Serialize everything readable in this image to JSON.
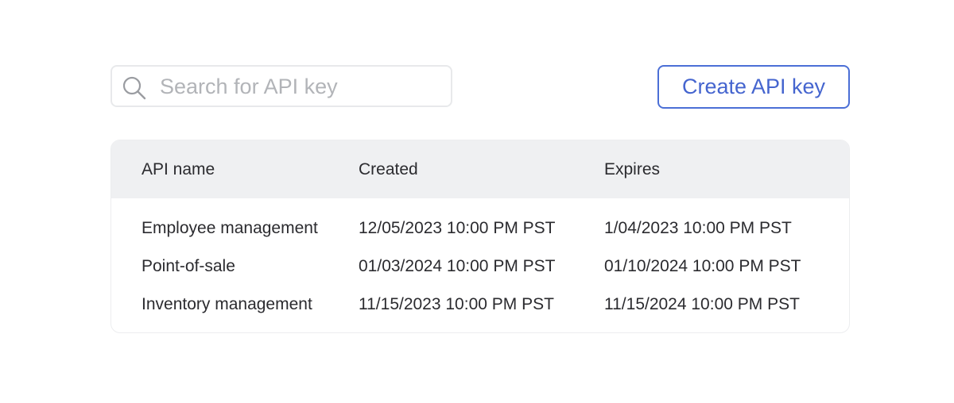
{
  "search": {
    "placeholder": "Search for API key",
    "value": "",
    "icon": "search-icon"
  },
  "actions": {
    "create_label": "Create API key",
    "accent_color": "#4565cf"
  },
  "table": {
    "columns": [
      "API name",
      "Created",
      "Expires"
    ],
    "rows": [
      {
        "name": "Employee management",
        "created": "12/05/2023 10:00 PM PST",
        "expires": "1/04/2023 10:00 PM PST"
      },
      {
        "name": "Point-of-sale",
        "created": "01/03/2024 10:00 PM PST",
        "expires": "01/10/2024 10:00 PM PST"
      },
      {
        "name": "Inventory management",
        "created": "11/15/2023 10:00 PM PST",
        "expires": "11/15/2024 10:00 PM PST"
      }
    ],
    "header_background": "#eff0f2"
  }
}
